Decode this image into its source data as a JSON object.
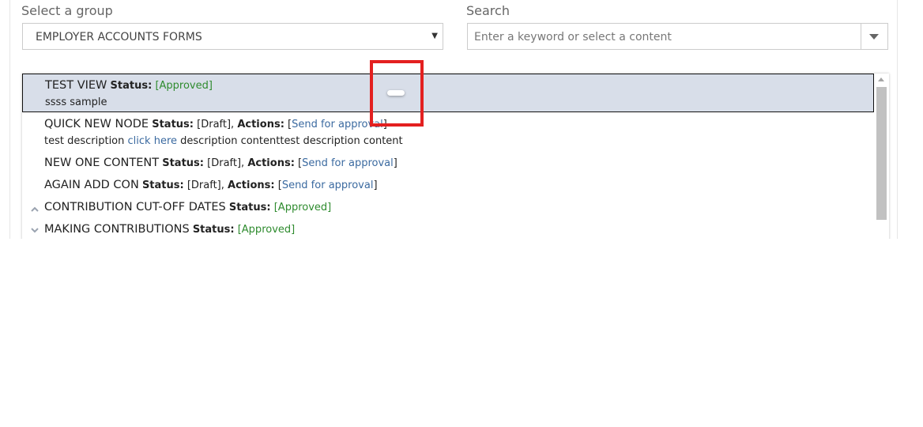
{
  "group_label": "Select a group",
  "group_selected": "EMPLOYER ACCOUNTS FORMS",
  "search_label": "Search",
  "search_placeholder": "Enter a keyword or select a content",
  "tree": {
    "status_label": "Status:",
    "actions_label": "Actions:",
    "rows": [
      {
        "title": "TEST VIEW",
        "status": "[Approved]",
        "desc": "ssss sample"
      },
      {
        "title": "QUICK NEW NODE",
        "status": "[Draft],",
        "action": "Send for approval",
        "desc_before": "test description",
        "desc_link": "click here",
        "desc_after": "description contenttest description content"
      },
      {
        "title": "NEW ONE CONTENT",
        "status": "[Draft],",
        "action": "Send for approval"
      },
      {
        "title": "AGAIN ADD CON",
        "status": "[Draft],",
        "action": "Send for approval"
      },
      {
        "title": "CONTRIBUTION CUT-OFF DATES",
        "status": "[Approved]",
        "expander": "chevron-up-icon"
      },
      {
        "title": "MAKING CONTRIBUTIONS",
        "status": "[Approved]",
        "expander": "chevron-down-icon"
      }
    ]
  },
  "bracket_open": "[",
  "bracket_close": "]",
  "colors": {
    "selected_row": "#d8dee9",
    "approved": "#2e8b2e",
    "link": "#3b6aa0",
    "highlight": "#e32020"
  }
}
